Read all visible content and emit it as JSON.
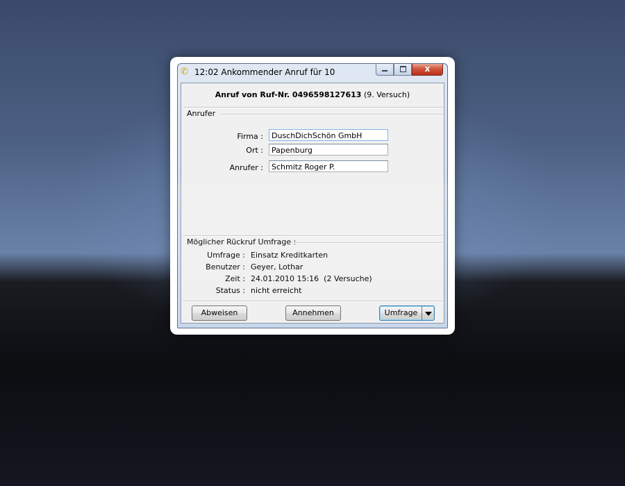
{
  "window": {
    "title": "12:02 Ankommender Anruf für 10",
    "icon": "phone-icon",
    "controls": {
      "minimize": "minimize",
      "maximize": "maximize",
      "close": "x"
    }
  },
  "heading": {
    "bold": "Anruf von Ruf-Nr. 0496598127613",
    "suffix": "(9. Versuch)"
  },
  "caller_group": {
    "title": "Anrufer",
    "fields": [
      {
        "label": "Firma :",
        "value": "DuschDichSchön GmbH"
      },
      {
        "label": "Ort :",
        "value": "Papenburg"
      },
      {
        "label": "Anrufer :",
        "value": "Schmitz Roger P."
      }
    ]
  },
  "callback_group": {
    "title": "Möglicher Rückruf Umfrage :",
    "rows": [
      {
        "label": "Umfrage :",
        "value": "Einsatz Kreditkarten"
      },
      {
        "label": "Benutzer :",
        "value": "Geyer, Lothar"
      },
      {
        "label": "Zeit :",
        "value": "24.01.2010 15:16  (2 Versuche)"
      },
      {
        "label": "Status :",
        "value": "nicht erreicht"
      }
    ]
  },
  "buttons": {
    "reject": "Abweisen",
    "accept": "Annehmen",
    "survey": "Umfrage"
  },
  "colors": {
    "title_gradient_top": "#dfe8f3",
    "close_button": "#c8412a",
    "default_button_border": "#3c7fb1"
  }
}
